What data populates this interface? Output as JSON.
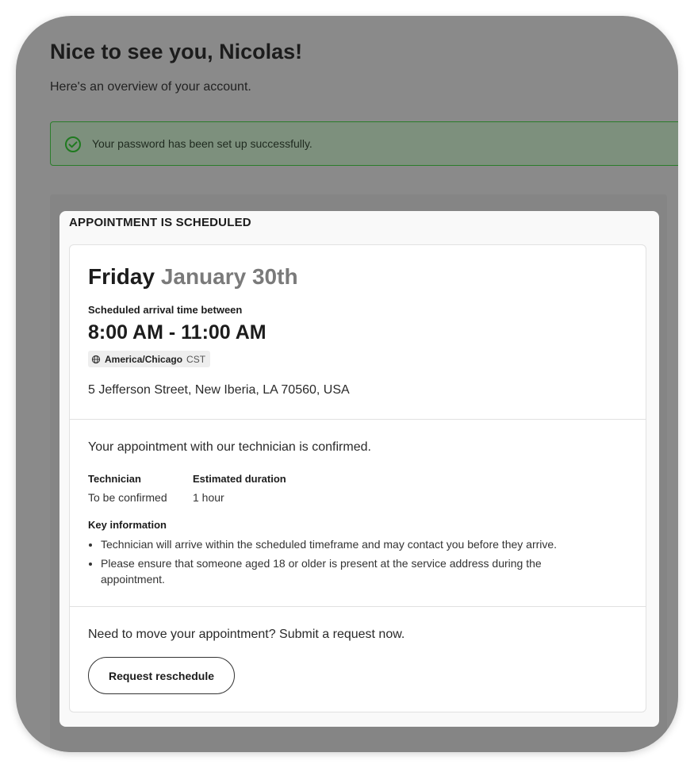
{
  "header": {
    "greeting": "Nice to see you, Nicolas!",
    "subtitle": "Here's an overview of your account."
  },
  "alert": {
    "message": "Your password has been set up successfully.",
    "icon": "check-circle-icon",
    "color": "#2a7d2a"
  },
  "appointment": {
    "status_title": "APPOINTMENT IS SCHEDULED",
    "day": "Friday",
    "date": "January 30th",
    "arrival_label": "Scheduled arrival time between",
    "arrival_window": "8:00 AM - 11:00 AM",
    "timezone": {
      "icon": "globe-icon",
      "name": "America/Chicago",
      "abbr": "CST"
    },
    "address": "5 Jefferson Street, New Iberia, LA 70560, USA",
    "confirmation": "Your appointment with our technician is confirmed.",
    "details": [
      {
        "label": "Technician",
        "value": "To be confirmed"
      },
      {
        "label": "Estimated duration",
        "value": "1 hour"
      }
    ],
    "key_info_label": "Key information",
    "key_info": [
      "Technician will arrive within the scheduled timeframe and may contact you before they arrive.",
      "Please ensure that someone aged 18 or older is present at the service address during the appointment."
    ],
    "reschedule_prompt": "Need to move your appointment? Submit a request now.",
    "reschedule_button": "Request reschedule"
  }
}
